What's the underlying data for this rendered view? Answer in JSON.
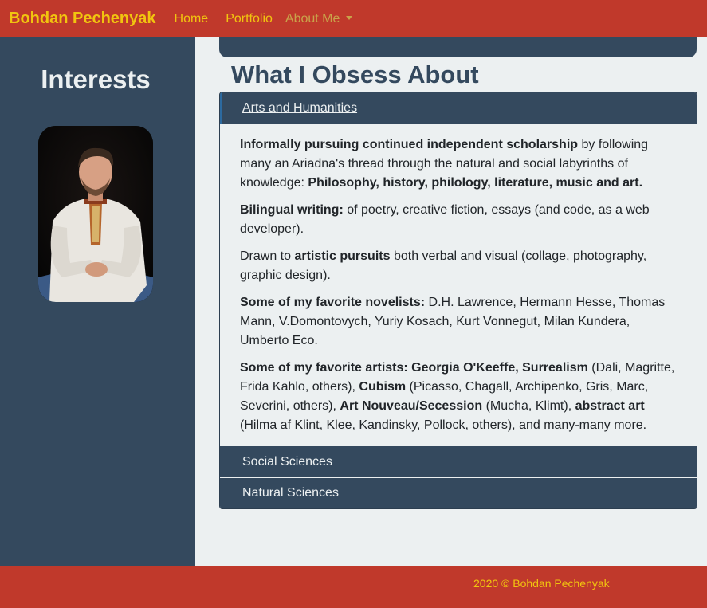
{
  "nav": {
    "brand": "Bohdan Pechenyak",
    "links": [
      {
        "label": "Home"
      },
      {
        "label": "Portfolio"
      },
      {
        "label": "About Me"
      }
    ]
  },
  "sidebar": {
    "title": "Interests",
    "photo_icon": "portrait-photo"
  },
  "main": {
    "title": "What I Obsess About",
    "accordion": [
      {
        "label": "Arts and Humanities",
        "expanded": true,
        "paragraphs": [
          [
            {
              "text": "Informally pursuing continued independent scholarship",
              "bold": true
            },
            {
              "text": " by following many an Ariadna's thread through the natural and social labyrinths of knowledge: ",
              "bold": false
            },
            {
              "text": "Philosophy, history, philology, literature, music and art.",
              "bold": true
            }
          ],
          [
            {
              "text": "Bilingual writing:",
              "bold": true
            },
            {
              "text": " of poetry, creative fiction, essays (and code, as a web developer).",
              "bold": false
            }
          ],
          [
            {
              "text": "Drawn to ",
              "bold": false
            },
            {
              "text": "artistic pursuits",
              "bold": true
            },
            {
              "text": " both verbal and visual (collage, photography, graphic design).",
              "bold": false
            }
          ],
          [
            {
              "text": "Some of my favorite novelists:",
              "bold": true
            },
            {
              "text": " D.H. Lawrence, Hermann Hesse, Thomas Mann, V.Domontovych, Yuriy Kosach, Kurt Vonnegut, Milan Kundera, Umberto Eco.",
              "bold": false
            }
          ],
          [
            {
              "text": "Some of my favorite artists: Georgia O'Keeffe, Surrealism",
              "bold": true
            },
            {
              "text": " (Dali, Magritte, Frida Kahlo, others), ",
              "bold": false
            },
            {
              "text": "Cubism",
              "bold": true
            },
            {
              "text": " (Picasso, Chagall, Archipenko, Gris, Marc, Severini, others), ",
              "bold": false
            },
            {
              "text": "Art Nouveau/Secession",
              "bold": true
            },
            {
              "text": " (Mucha, Klimt), ",
              "bold": false
            },
            {
              "text": "abstract art",
              "bold": true
            },
            {
              "text": " (Hilma af Klint, Klee, Kandinsky, Pollock, others), and many-many more.",
              "bold": false
            }
          ]
        ]
      },
      {
        "label": "Social Sciences",
        "expanded": false
      },
      {
        "label": "Natural Sciences",
        "expanded": false
      }
    ]
  },
  "footer": {
    "text": "2020 © Bohdan Pechenyak"
  },
  "colors": {
    "nav_bg": "#c0392b",
    "brand": "#f1c40f",
    "sidebar_bg": "#34495e",
    "page_bg": "#ecf0f1"
  }
}
